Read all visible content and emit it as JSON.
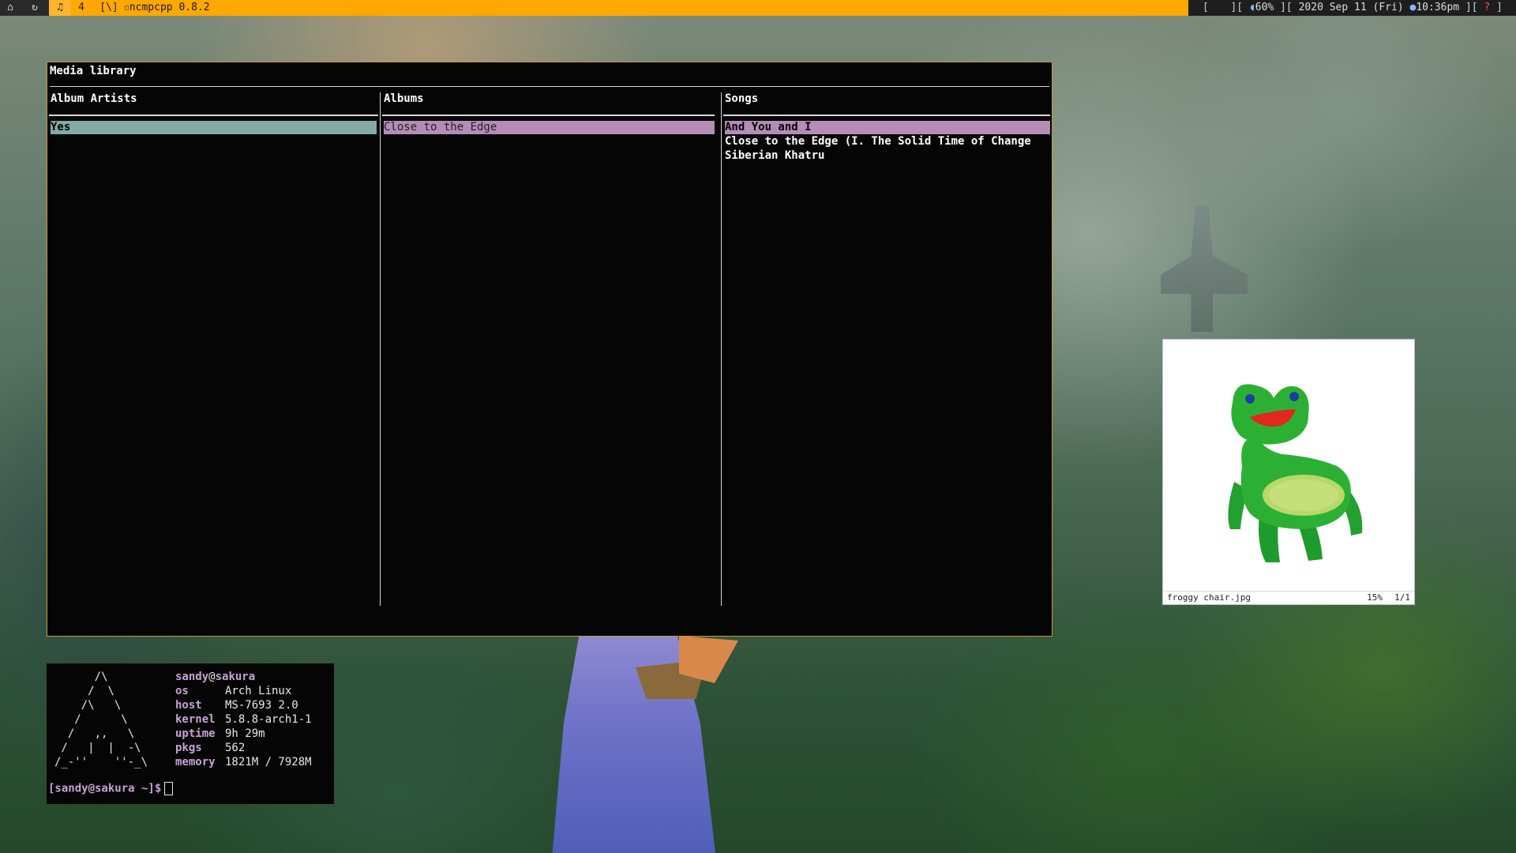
{
  "topbar": {
    "workspaces": [
      {
        "icon": "home-icon",
        "glyph": "⌂"
      },
      {
        "icon": "refresh-icon",
        "glyph": "↻"
      },
      {
        "icon": "music-note-icon",
        "glyph": "♫"
      },
      {
        "label": "4"
      },
      {
        "label": "[\\]"
      }
    ],
    "window_title": "ncmpcpp 0.8.2",
    "status": {
      "open_bracket": "[",
      "volume_prefix": "][",
      "volume": "60%",
      "date_prefix": "][",
      "date": "2020 Sep 11 (Fri)",
      "time": "10:36pm",
      "alert_prefix": "][",
      "alert": "?",
      "close_bracket": "]"
    }
  },
  "ncmpcpp": {
    "title": "Media library",
    "columns": {
      "artists": {
        "header": "Album Artists",
        "items": [
          "Yes"
        ]
      },
      "albums": {
        "header": "Albums",
        "items": [
          "Close to the Edge"
        ]
      },
      "songs": {
        "header": "Songs",
        "items": [
          "And You and I",
          "Close to the Edge (I. The Solid Time of Change",
          "Siberian Khatru"
        ]
      }
    }
  },
  "viewer": {
    "filename": "froggy chair.jpg",
    "zoom": "15%",
    "page": "1/1"
  },
  "terminal": {
    "ascii_art": "      /\\\n     /  \\\n    /\\   \\\n   /      \\\n  /   ,,   \\\n /   |  |  -\\\n/_-''    ''-_\\",
    "user": "sandy",
    "at": "@",
    "host_name": "sakura",
    "fields": [
      {
        "key": "os",
        "value": "Arch Linux"
      },
      {
        "key": "host",
        "value": "MS-7693 2.0"
      },
      {
        "key": "kernel",
        "value": "5.8.8-arch1-1"
      },
      {
        "key": "uptime",
        "value": "9h 29m"
      },
      {
        "key": "pkgs",
        "value": "562"
      },
      {
        "key": "memory",
        "value": "1821M / 7928M"
      }
    ],
    "prompt": "[sandy@sakura ~]$"
  },
  "colors": {
    "bar": "#ffa800",
    "accent_pink": "#b58cb8",
    "accent_teal": "#82aaa6",
    "window_border": "#c89a30"
  }
}
